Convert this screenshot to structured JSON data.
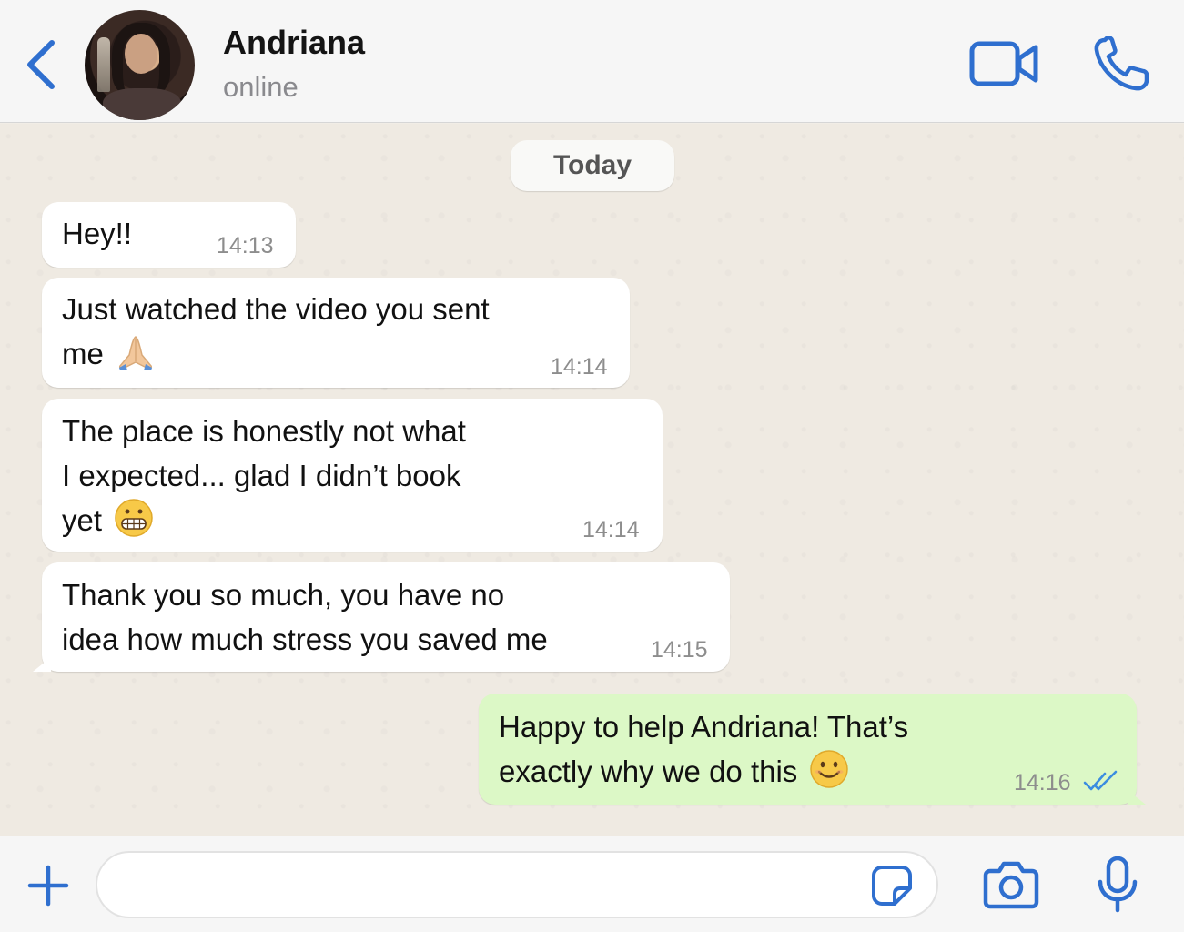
{
  "header": {
    "contact_name": "Andriana",
    "status": "online",
    "accent_color": "#2f6fcf"
  },
  "chat": {
    "date_label": "Today",
    "messages": [
      {
        "direction": "incoming",
        "text": "Hey!!",
        "time": "14:13"
      },
      {
        "direction": "incoming",
        "text": "Just watched the video you sent\nme",
        "emoji": "folded-hands-emoji",
        "time": "14:14"
      },
      {
        "direction": "incoming",
        "text": "The place is honestly not what\nI expected... glad I didn’t book\nyet",
        "emoji": "grimacing-face-emoji",
        "time": "14:14"
      },
      {
        "direction": "incoming",
        "text": "Thank you so much, you have no\nidea how much stress you saved me",
        "time": "14:15"
      },
      {
        "direction": "outgoing",
        "text": "Happy to help Andriana! That’s\nexactly why we do this",
        "emoji": "smiling-face-emoji",
        "time": "14:16",
        "status": "read"
      }
    ],
    "incoming_bubble_color": "#ffffff",
    "outgoing_bubble_color": "#dcf8c6"
  },
  "composer": {
    "value": "",
    "placeholder": ""
  },
  "icons": {
    "back": "chevron-left-icon",
    "video": "video-camera-icon",
    "call": "phone-icon",
    "plus": "plus-icon",
    "sticker": "sticker-icon",
    "camera": "camera-icon",
    "mic": "microphone-icon",
    "read": "double-check-icon"
  }
}
